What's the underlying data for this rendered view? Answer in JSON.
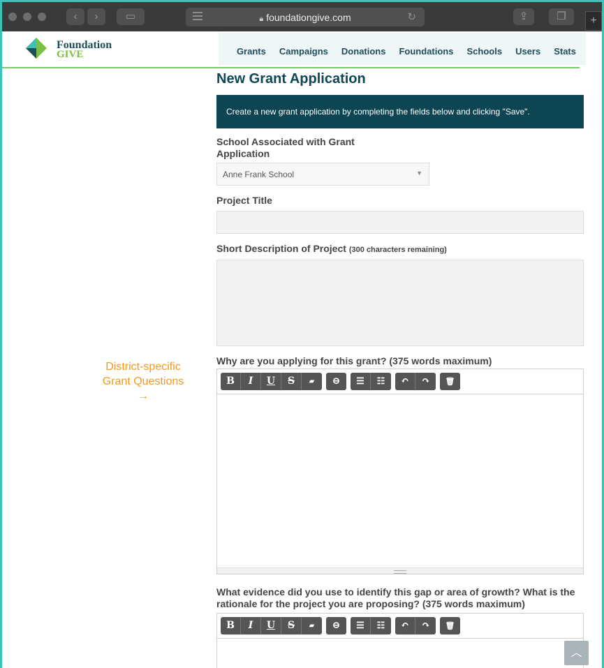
{
  "browser": {
    "url": "foundationgive.com"
  },
  "logo": {
    "line1": "Foundation",
    "line2": "GIVE"
  },
  "nav": {
    "items": [
      "Grants",
      "Campaigns",
      "Donations",
      "Foundations",
      "Schools",
      "Users",
      "Stats"
    ]
  },
  "annotation": {
    "line1": "District-specific",
    "line2": "Grant Questions",
    "arrow": "→"
  },
  "form": {
    "title": "New Grant Application",
    "banner": "Create a new grant application by completing the fields below and clicking \"Save\".",
    "school_label_line1": "School Associated with Grant",
    "school_label_line2": "Application",
    "school_value": "Anne Frank School",
    "project_title_label": "Project Title",
    "project_title_value": "",
    "short_desc_label": "Short Description of Project",
    "short_desc_remaining": "(300 characters remaining)",
    "q1_label": "Why are you applying for this grant? (375 words maximum)",
    "q2_label": "What evidence did you use to identify this gap or area of growth? What is the rationale for the project you are proposing? (375 words maximum)"
  },
  "toolbar": {
    "bold": "B",
    "italic": "I",
    "underline": "U",
    "strike": "S",
    "eraser": "▰",
    "link": "⊖",
    "ul": "☰",
    "ol": "☷",
    "undo": "↶",
    "redo": "↷",
    "trash": "🗑"
  },
  "colors": {
    "accent_teal": "#3ec1b8",
    "brand_dark": "#0d4552",
    "brand_green": "#7bc043",
    "annotation_orange": "#f29a1e"
  }
}
